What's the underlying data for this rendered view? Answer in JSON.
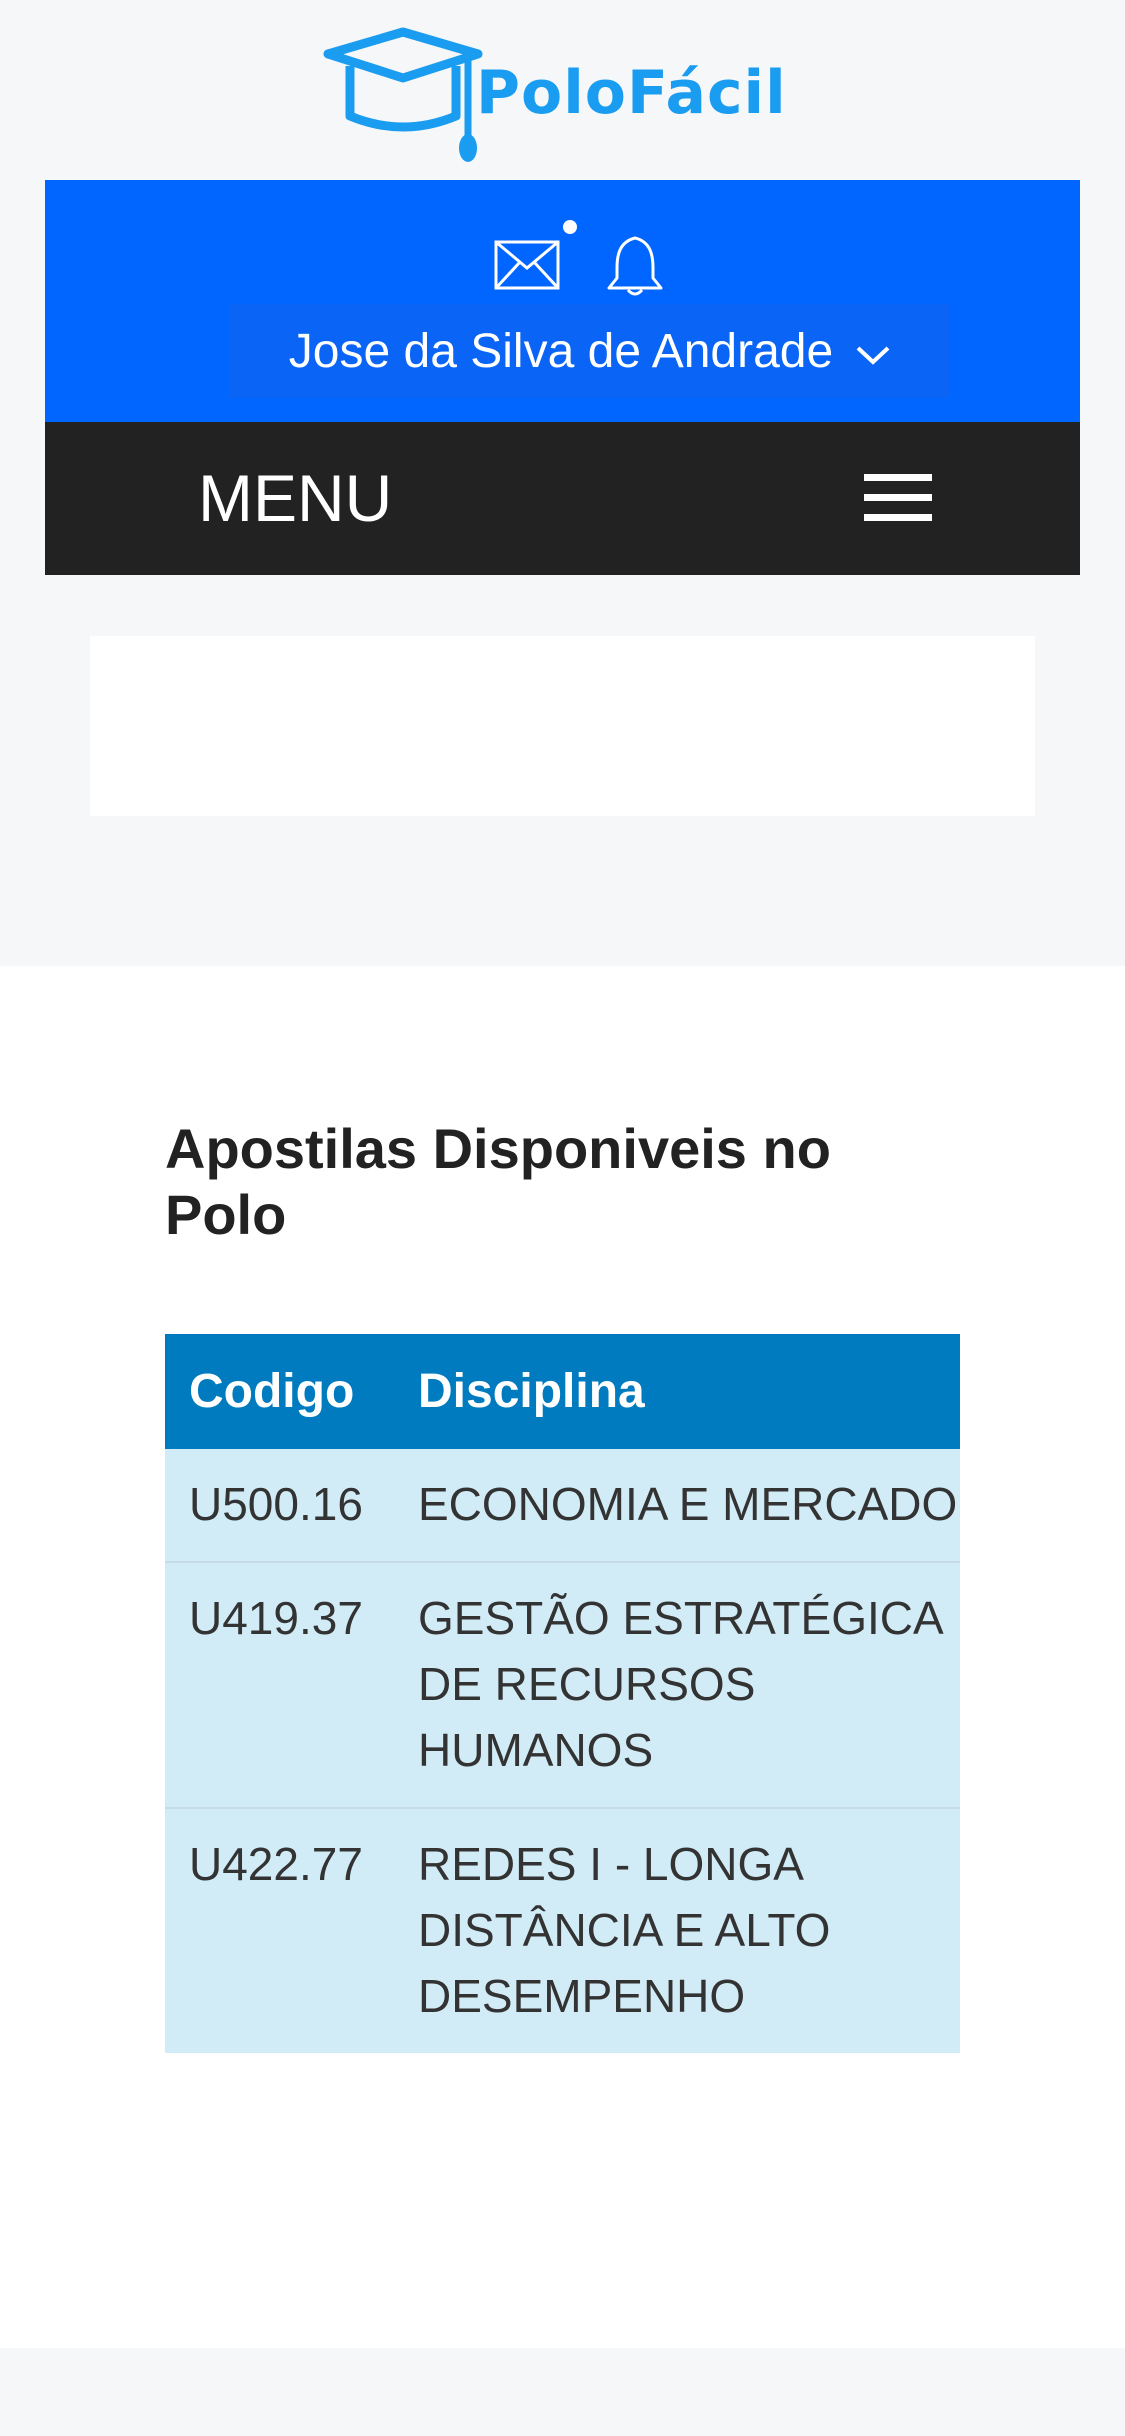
{
  "brand": {
    "name": "PoloFácil",
    "color": "#1a9cf0"
  },
  "header": {
    "icons": [
      "mail-icon",
      "bell-icon"
    ],
    "mail_unread_dot": true,
    "user_name": "Jose da Silva de Andrade",
    "background_color": "#0066ff"
  },
  "nav": {
    "menu_label": "MENU",
    "background_color": "#222222"
  },
  "section": {
    "title": "Apostilas Disponiveis no Polo",
    "table": {
      "header_color": "#007bbf",
      "row_color": "#d2ecf7",
      "columns": [
        "Codigo",
        "Disciplina"
      ],
      "rows": [
        {
          "codigo": "U500.16",
          "disciplina": "ECONOMIA E MERCADO"
        },
        {
          "codigo": "U419.37",
          "disciplina": "GESTÃO ESTRATÉGICA DE RECURSOS HUMANOS"
        },
        {
          "codigo": "U422.77",
          "disciplina": "REDES I - LONGA DISTÂNCIA E ALTO DESEMPENHO"
        }
      ]
    }
  }
}
